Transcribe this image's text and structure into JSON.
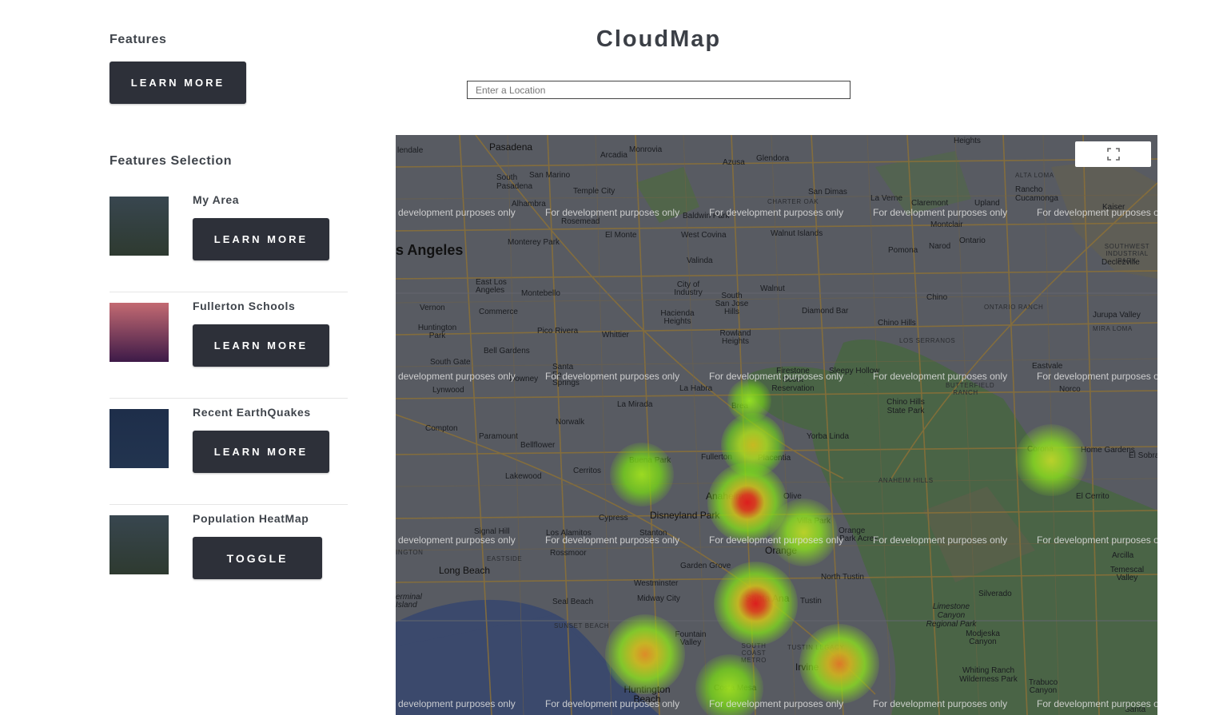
{
  "app": {
    "title": "CloudMap"
  },
  "search": {
    "placeholder": "Enter a Location",
    "value": ""
  },
  "features": {
    "heading": "Features",
    "learn_more_label": "LEARN MORE"
  },
  "features_selection": {
    "heading": "Features Selection",
    "items": [
      {
        "title": "My Area",
        "button_label": "LEARN MORE",
        "thumb_colors": [
          "#38464f",
          "#2e3a30"
        ]
      },
      {
        "title": "Fullerton Schools",
        "button_label": "LEARN MORE",
        "thumb_colors": [
          "#c36a72",
          "#3d1a48"
        ]
      },
      {
        "title": "Recent EarthQuakes",
        "button_label": "LEARN MORE",
        "thumb_colors": [
          "#1e2e4a",
          "#22344f"
        ]
      },
      {
        "title": "Population HeatMap",
        "button_label": "TOGGLE",
        "thumb_colors": [
          "#38464f",
          "#2e3a30"
        ]
      }
    ]
  },
  "map": {
    "watermark": "For development purposes only",
    "watermark_edge": "development purposes only",
    "watermark_edge_right": "For development purposes o",
    "fullscreen_icon": "fullscreen-icon",
    "places": [
      "lendale",
      "Pasadena",
      "Monrovia",
      "Arcadia",
      "Azusa",
      "Glendora",
      "Heights",
      "South Pasadena",
      "San Marino",
      "Temple City",
      "Alhambra",
      "Rosemead",
      "Baldwin Park",
      "San Dimas",
      "La Verne",
      "Claremont",
      "Upland",
      "Rancho Cucamonga",
      "Kaiser",
      "ALTA LOMA",
      "CHARTER OAK",
      "s Angeles",
      "Monterey Park",
      "El Monte",
      "West Covina",
      "Walnut Islands",
      "Montclair",
      "Ontario",
      "Pomona",
      "Narod",
      "Valinda",
      "SOUTHWEST INDUSTRIAL PARK",
      "Declezville",
      "East Los Angeles",
      "Commerce",
      "Montebello",
      "City of Industry",
      "Walnut",
      "South San Jose Hills",
      "Diamond Bar",
      "Chino",
      "ONTARIO RANCH",
      "Jurupa Valley",
      "Vernon",
      "Huntington Park",
      "Pico Rivera",
      "Whittier",
      "Hacienda Heights",
      "Rowland Heights",
      "Chino Hills",
      "MIRA LOMA",
      "Bell Gardens",
      "LOS SERRANOS",
      "South Gate",
      "Santa Fe Springs",
      "Downey",
      "Firestone Scout Reservation",
      "Sleepy Hollow",
      "Eastvale",
      "Lynwood",
      "La Habra",
      "Chino Hills State Park",
      "BUTTERFIELD RANCH",
      "Norco",
      "La Mirada",
      "Brea",
      "Compton",
      "Paramount",
      "Bellflower",
      "Norwalk",
      "Yorba Linda",
      "Corona",
      "Home Gardens",
      "El Sobra",
      "Buena Park",
      "Fullerton",
      "Placentia",
      "Cerritos",
      "Lakewood",
      "Anaheim",
      "ANAHEIM HILLS",
      "El Cerrito",
      "Olive",
      "Cypress",
      "Disneyland Park",
      "Villa Park",
      "Signal Hill",
      "Los Alamitos",
      "Stanton",
      "Orange",
      "Park Acres",
      "Rossmoor",
      "EASTSIDE",
      "Orange",
      "Arcilla",
      "Long Beach",
      "Garden Grove",
      "North Tustin",
      "Temescal Valley",
      "Westminster",
      "Midway City",
      "Santa Ana",
      "Tustin",
      "Silverado",
      "Seal Beach",
      "SUNSET BEACH",
      "Fountain Valley",
      "SOUTH COAST METRO",
      "TUSTIN LEGACY",
      "Limestone Canyon Regional Park",
      "Modjeska Canyon",
      "Irvine",
      "Whiting Ranch Wilderness Park",
      "Huntington Beach",
      "Costa Mesa",
      "Trabuco Canyon",
      "Santa",
      "erminal Island",
      "INGTON"
    ]
  },
  "heat_points": [
    {
      "name": "Brea",
      "intensity": 0.35
    },
    {
      "name": "Fullerton north",
      "intensity": 0.6
    },
    {
      "name": "Buena Park",
      "intensity": 0.45
    },
    {
      "name": "Anaheim",
      "intensity": 1.0
    },
    {
      "name": "Villa Park",
      "intensity": 0.5
    },
    {
      "name": "Santa Ana",
      "intensity": 0.95
    },
    {
      "name": "Huntington Beach",
      "intensity": 0.75
    },
    {
      "name": "Costa Mesa",
      "intensity": 0.4
    },
    {
      "name": "Irvine",
      "intensity": 0.8
    },
    {
      "name": "Corona",
      "intensity": 0.5
    }
  ],
  "colors": {
    "button_bg": "#2d3039",
    "text": "#3f444b",
    "map_base": "#5d6168",
    "ocean": "#3b4c74",
    "park": "#4a6b46",
    "road": "#9a7a36"
  }
}
